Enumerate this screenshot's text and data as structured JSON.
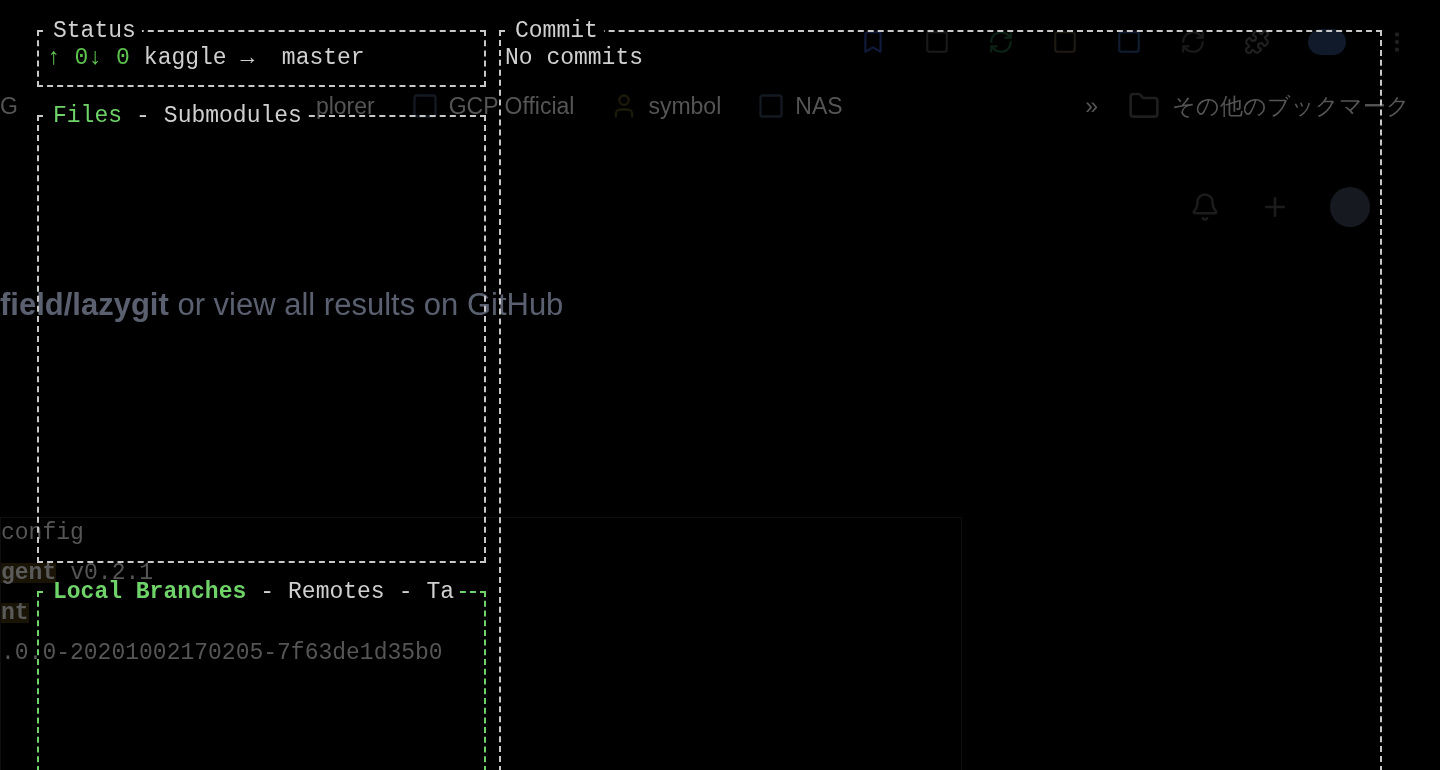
{
  "backdrop": {
    "bookmarks": [
      {
        "label": "G"
      },
      {
        "label": "plorer"
      },
      {
        "label": "GCP Official"
      },
      {
        "label": "symbol"
      },
      {
        "label": "NAS"
      }
    ],
    "more_bookmarks": "»",
    "other_bookmarks": "その他のブックマーク",
    "search_heading": {
      "repo": "field/lazygit",
      "rest": "or view all results on GitHub"
    },
    "code_lines": [
      {
        "kind": "plain",
        "text": "config"
      },
      {
        "kind": "tagged",
        "tag": "gent",
        "text": "v0.2.1"
      },
      {
        "kind": "tag",
        "tag": "nt"
      },
      {
        "kind": "plain",
        "text": ".0.0-20201002170205-7f63de1d35b0"
      }
    ]
  },
  "status_panel": {
    "title": "Status",
    "sync": "↑ 0↓ 0",
    "text": "kaggle →  master"
  },
  "files_panel": {
    "focused": false,
    "separator": "-",
    "tabs": [
      {
        "label": "Files",
        "selected": true
      },
      {
        "label": "Submodules",
        "selected": false
      }
    ]
  },
  "branches_panel": {
    "focused": true,
    "separator": "-",
    "tabs": [
      {
        "label": "Local Branches",
        "selected": true
      },
      {
        "label": "Remotes",
        "selected": false
      },
      {
        "label": "Ta",
        "selected": false
      }
    ]
  },
  "commit_panel": {
    "title": "Commit",
    "text": "No commits"
  }
}
